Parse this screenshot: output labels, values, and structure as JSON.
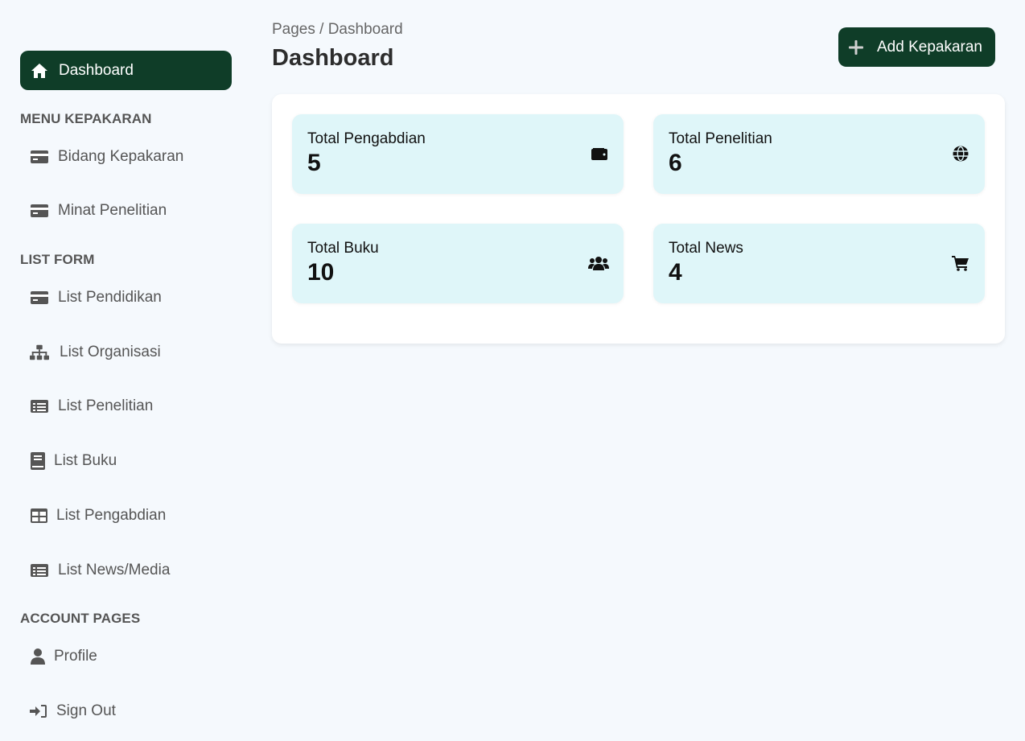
{
  "sidebar": {
    "active_item": {
      "label": "Dashboard",
      "icon": "home-icon"
    },
    "sections": [
      {
        "title": "MENU KEPAKARAN"
      },
      {
        "title": "LIST FORM"
      },
      {
        "title": "ACCOUNT PAGES"
      }
    ],
    "items": [
      {
        "label": "Bidang Kepakaran",
        "icon": "credit-card-icon"
      },
      {
        "label": "Minat Penelitian",
        "icon": "credit-card-icon"
      },
      {
        "label": "List Pendidikan",
        "icon": "credit-card-icon"
      },
      {
        "label": "List Organisasi",
        "icon": "sitemap-icon"
      },
      {
        "label": "List Penelitian",
        "icon": "list-alt-icon"
      },
      {
        "label": "List Buku",
        "icon": "book-icon"
      },
      {
        "label": "List Pengabdian",
        "icon": "table-icon"
      },
      {
        "label": "List News/Media",
        "icon": "list-alt-icon"
      },
      {
        "label": "Profile",
        "icon": "user-icon"
      },
      {
        "label": "Sign Out",
        "icon": "sign-in-icon"
      }
    ]
  },
  "header": {
    "breadcrumb": "Pages / Dashboard",
    "title": "Dashboard",
    "add_button_label": "Add Kepakaran"
  },
  "stats": [
    {
      "label": "Total Pengabdian",
      "value": "5",
      "icon": "wallet-icon"
    },
    {
      "label": "Total Penelitian",
      "value": "6",
      "icon": "globe-icon"
    },
    {
      "label": "Total Buku",
      "value": "10",
      "icon": "users-icon"
    },
    {
      "label": "Total News",
      "value": "4",
      "icon": "shopping-cart-icon"
    }
  ],
  "colors": {
    "primary": "#0f3d28",
    "background": "#f5f9fd",
    "card": "#dff6f9"
  }
}
